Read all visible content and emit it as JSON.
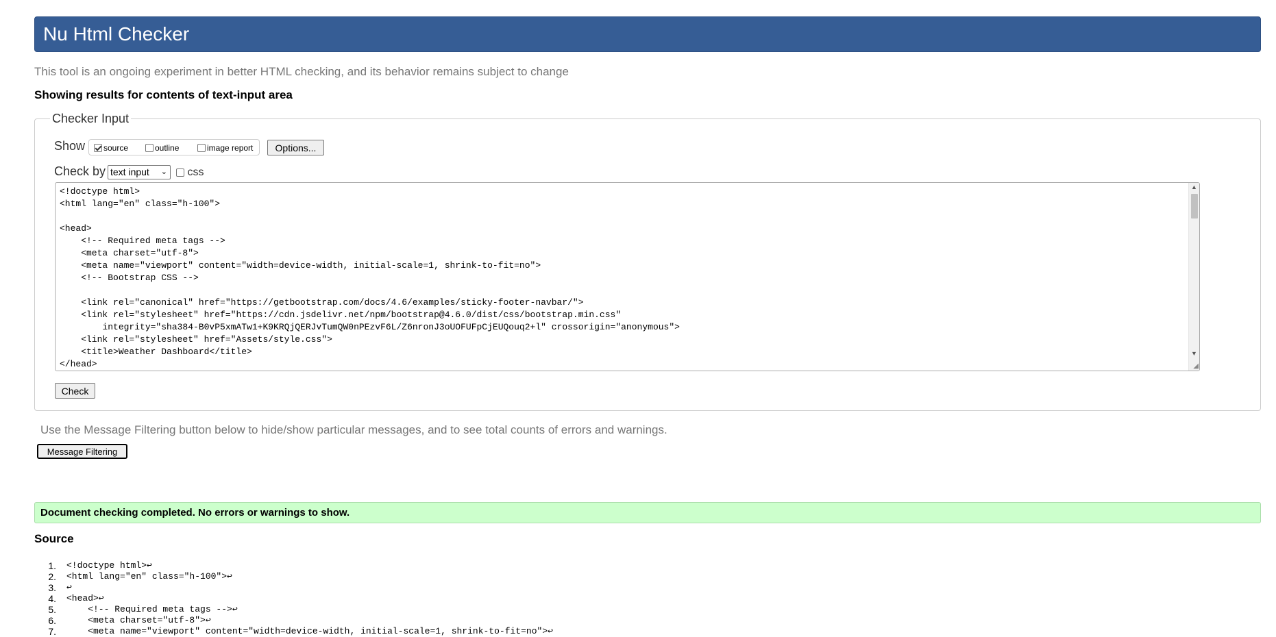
{
  "header": {
    "title": "Nu Html Checker"
  },
  "tagline": "This tool is an ongoing experiment in better HTML checking, and its behavior remains subject to change",
  "showing_results": "Showing results for contents of text-input area",
  "checker": {
    "legend": "Checker Input",
    "show_label": "Show",
    "show_options": [
      {
        "label": "source",
        "checked": true
      },
      {
        "label": "outline",
        "checked": false
      },
      {
        "label": "image report",
        "checked": false
      }
    ],
    "options_button": "Options...",
    "check_by_label": "Check by",
    "check_by_selected": "text input",
    "css_label": "css",
    "css_checked": false,
    "textarea_value": "<!doctype html>\n<html lang=\"en\" class=\"h-100\">\n\n<head>\n    <!-- Required meta tags -->\n    <meta charset=\"utf-8\">\n    <meta name=\"viewport\" content=\"width=device-width, initial-scale=1, shrink-to-fit=no\">\n    <!-- Bootstrap CSS -->\n\n    <link rel=\"canonical\" href=\"https://getbootstrap.com/docs/4.6/examples/sticky-footer-navbar/\">\n    <link rel=\"stylesheet\" href=\"https://cdn.jsdelivr.net/npm/bootstrap@4.6.0/dist/css/bootstrap.min.css\"\n        integrity=\"sha384-B0vP5xmATw1+K9KRQjQERJvTumQW0nPEzvF6L/Z6nronJ3oUOFUFpCjEUQouq2+l\" crossorigin=\"anonymous\">\n    <link rel=\"stylesheet\" href=\"Assets/style.css\">\n    <title>Weather Dashboard</title>\n</head>",
    "check_button": "Check"
  },
  "filter_note": "Use the Message Filtering button below to hide/show particular messages, and to see total counts of errors and warnings.",
  "filter_button": "Message Filtering",
  "result_message": "Document checking completed. No errors or warnings to show.",
  "source_heading": "Source",
  "source_lines": [
    {
      "num": "1.",
      "text": "<!doctype html>↩"
    },
    {
      "num": "2.",
      "text": "<html lang=\"en\" class=\"h-100\">↩"
    },
    {
      "num": "3.",
      "text": "↩"
    },
    {
      "num": "4.",
      "text": "<head>↩"
    },
    {
      "num": "5.",
      "text": "    <!-- Required meta tags -->↩"
    },
    {
      "num": "6.",
      "text": "    <meta charset=\"utf-8\">↩"
    },
    {
      "num": "7.",
      "text": "    <meta name=\"viewport\" content=\"width=device-width, initial-scale=1, shrink-to-fit=no\">↩"
    }
  ],
  "colors": {
    "banner": "#365d95",
    "success_bg": "#ccffcc",
    "muted_text": "#777777"
  },
  "icons": {
    "scroll_up": "scroll-up-arrow-icon",
    "scroll_down": "scroll-down-arrow-icon",
    "select_chevron": "chevron-down-icon",
    "resize": "resize-grip-icon"
  }
}
